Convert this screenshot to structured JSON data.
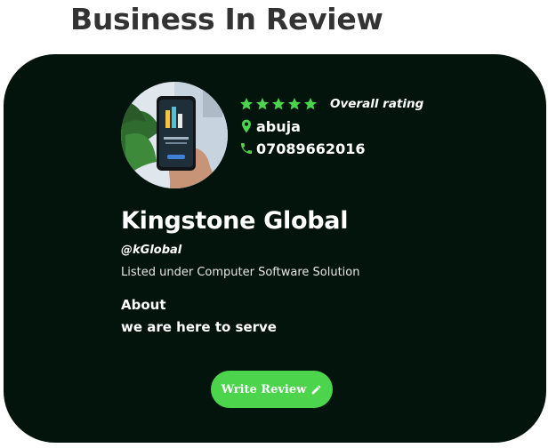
{
  "page": {
    "title": "Business In Review"
  },
  "business": {
    "name": "Kingstone Global",
    "handle": "@kGlobal",
    "listed": "Listed under Computer Software Solution",
    "rating": 5,
    "rating_label": "Overall rating",
    "location": "abuja",
    "phone": "07089662016",
    "about_heading": "About",
    "about_text": "we are here to serve"
  },
  "actions": {
    "write_review_label": "Write Review"
  },
  "icons": {
    "star": "star-icon",
    "location": "map-pin-icon",
    "phone": "phone-icon",
    "pen": "pencil-icon"
  },
  "colors": {
    "card_background": "#03140d",
    "accent_green": "#4cd44c",
    "title_text": "#333333"
  }
}
